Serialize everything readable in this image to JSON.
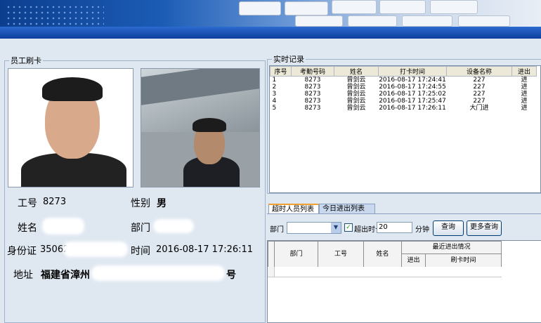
{
  "banner": {
    "name": "keyboard-banner"
  },
  "employee_card": {
    "group_title": "员工刷卡",
    "labels": {
      "id": "工号",
      "gender": "性别",
      "name": "姓名",
      "department": "部门",
      "id_card": "身份证",
      "time": "时间",
      "address": "地址"
    },
    "values": {
      "id": "8273",
      "gender": "男",
      "name": "",
      "department": "",
      "id_card": "35062",
      "time": "2016-08-17 17:26:11",
      "address_start": "福建省漳州",
      "address_end": "号"
    }
  },
  "realtime": {
    "group_title": "实时记录",
    "columns": [
      "序号",
      "考勤号码",
      "姓名",
      "打卡时间",
      "设备名称",
      "进出"
    ],
    "rows": [
      [
        "1",
        "8273",
        "曾剑云",
        "2016-08-17 17:24:41",
        "227",
        "进"
      ],
      [
        "2",
        "8273",
        "曾剑云",
        "2016-08-17 17:24:55",
        "227",
        "进"
      ],
      [
        "3",
        "8273",
        "曾剑云",
        "2016-08-17 17:25:02",
        "227",
        "进"
      ],
      [
        "4",
        "8273",
        "曾剑云",
        "2016-08-17 17:25:47",
        "227",
        "进"
      ],
      [
        "5",
        "8273",
        "曾剑云",
        "2016-08-17 17:26:11",
        "大门进",
        "进"
      ]
    ]
  },
  "tabs": [
    {
      "label": "超时人员列表",
      "active": true
    },
    {
      "label": "今日进出列表",
      "active": false
    }
  ],
  "filter": {
    "department_label": "部门",
    "department_value": "",
    "timeout_checkbox_label": "超出时长",
    "timeout_checked": true,
    "timeout_value": "20",
    "unit": "分钟",
    "query_button": "查询",
    "more_query_button": "更多查询"
  },
  "overtime_grid": {
    "headers": {
      "department": "部门",
      "id": "工号",
      "name": "姓名",
      "recent": "最近进出情况",
      "in_out": "进出",
      "swipe_time": "刷卡时间"
    }
  },
  "colors": {
    "accent_tab": "#f0a030",
    "panel_bg": "#dfe7f1",
    "banner_dark": "#0c3e8e"
  }
}
